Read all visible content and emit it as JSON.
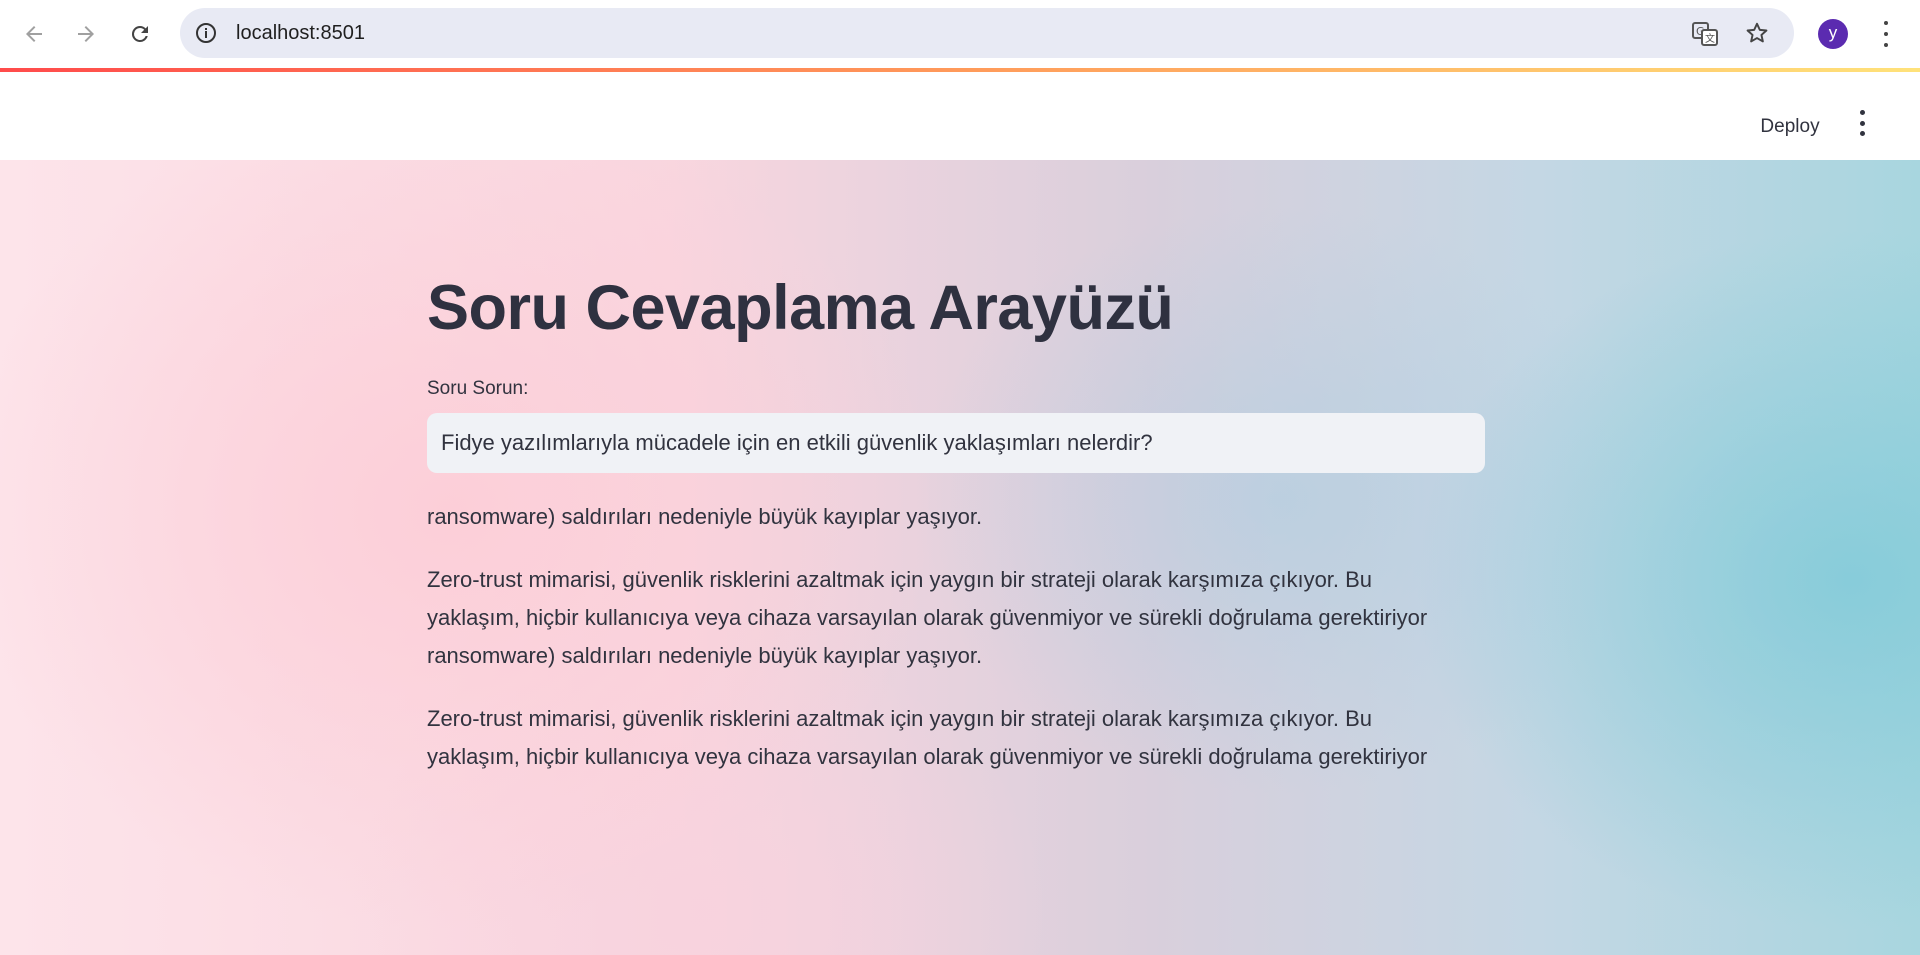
{
  "browser": {
    "url": "localhost:8501",
    "avatar_letter": "y"
  },
  "app_header": {
    "deploy_label": "Deploy"
  },
  "main": {
    "title": "Soru Cevaplama Arayüzü",
    "input_label": "Soru Sorun:",
    "input_value": "Fidye yazılımlarıyla mücadele için en etkili güvenlik yaklaşımları nelerdir?",
    "answer_lines": [
      "ransomware) saldırıları nedeniyle büyük kayıplar yaşıyor.",
      "Zero-trust mimarisi, güvenlik risklerini azaltmak için yaygın bir strateji olarak karşımıza çıkıyor. Bu",
      "yaklaşım, hiçbir kullanıcıya veya cihaza varsayılan olarak güvenmiyor ve sürekli doğrulama gerektiriyor",
      "ransomware) saldırıları nedeniyle büyük kayıplar yaşıyor.",
      "Zero-trust mimarisi, güvenlik risklerini azaltmak için yaygın bir strateji olarak karşımıza çıkıyor. Bu",
      "yaklaşım, hiçbir kullanıcıya veya cihaza varsayılan olarak güvenmiyor ve sürekli doğrulama gerektiriyor"
    ]
  },
  "colors": {
    "accent_line_start": "#ff4b4b",
    "accent_line_end": "#ffe27a",
    "avatar_bg": "#5b2bb0",
    "text": "#31333f"
  },
  "icons": [
    "back-arrow-icon",
    "forward-arrow-icon",
    "reload-icon",
    "site-info-icon",
    "translate-icon",
    "bookmark-star-icon",
    "kebab-menu-icon"
  ]
}
